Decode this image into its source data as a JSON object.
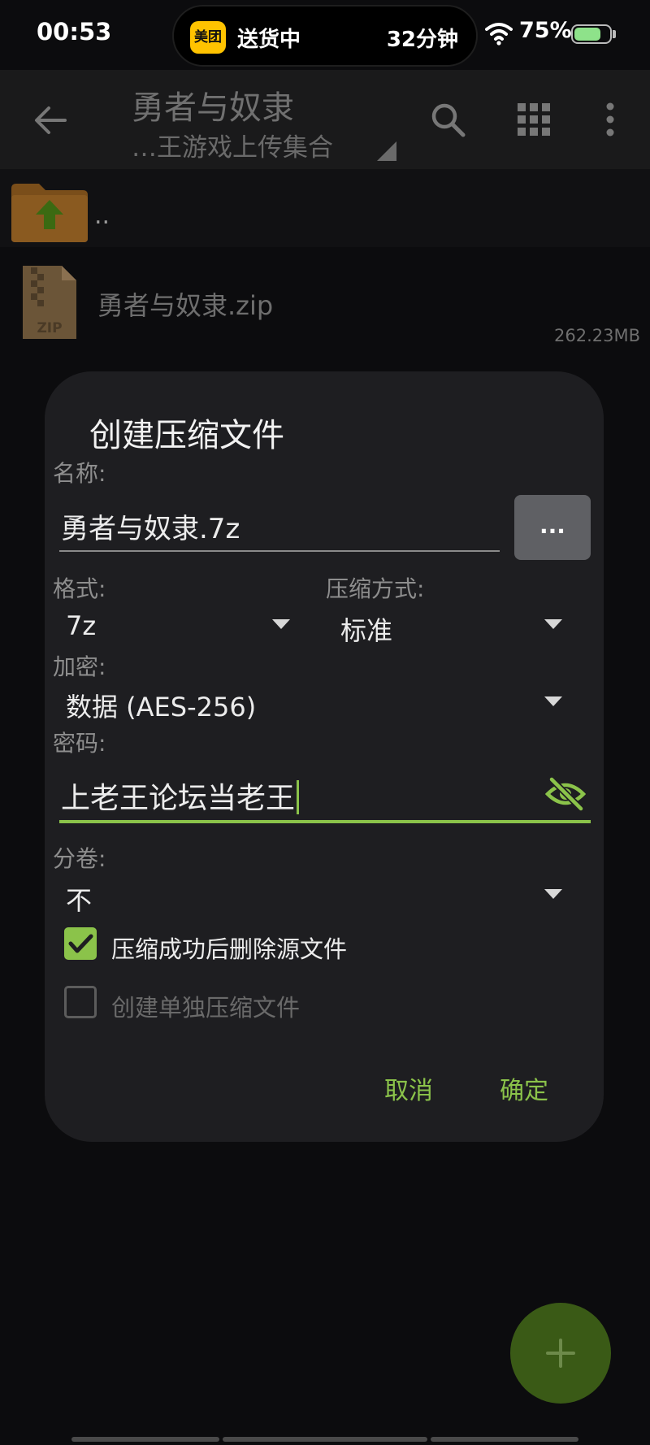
{
  "status_bar": {
    "time": "00:53",
    "island": {
      "app_logo": "美团",
      "status": "送货中",
      "eta": "32分钟"
    },
    "battery_percent": "75%",
    "battery_level": 0.75,
    "icons": [
      "wifi-icon",
      "battery-icon"
    ]
  },
  "app_bar": {
    "title": "勇者与奴隶",
    "subtitle": "…王游戏上传集合",
    "icons": [
      "back-arrow-icon",
      "search-icon",
      "grid-view-icon",
      "more-vert-icon"
    ]
  },
  "file_list": {
    "parent_dir": "..",
    "files": [
      {
        "name": "勇者与奴隶.zip",
        "size": "262.23MB",
        "icon": "zip-file-icon"
      }
    ]
  },
  "dialog": {
    "title": "创建压缩文件",
    "name_label": "名称:",
    "name_value": "勇者与奴隶.7z",
    "browse_label": "...",
    "format_label": "格式:",
    "format_value": "7z",
    "method_label": "压缩方式:",
    "method_value": "标准",
    "encryption_label": "加密:",
    "encryption_value": "数据 (AES-256)",
    "password_label": "密码:",
    "password_value": "上老王论坛当老王",
    "split_label": "分卷:",
    "split_value": "不",
    "delete_source": {
      "label": "压缩成功后删除源文件",
      "checked": true
    },
    "separate_archives": {
      "label": "创建单独压缩文件",
      "checked": false
    },
    "cancel_label": "取消",
    "ok_label": "确定"
  },
  "colors": {
    "accent": "#8bc34a",
    "background": "#0c0c0e",
    "dialog": "#1e1e21",
    "fab": "#3a5a16"
  }
}
